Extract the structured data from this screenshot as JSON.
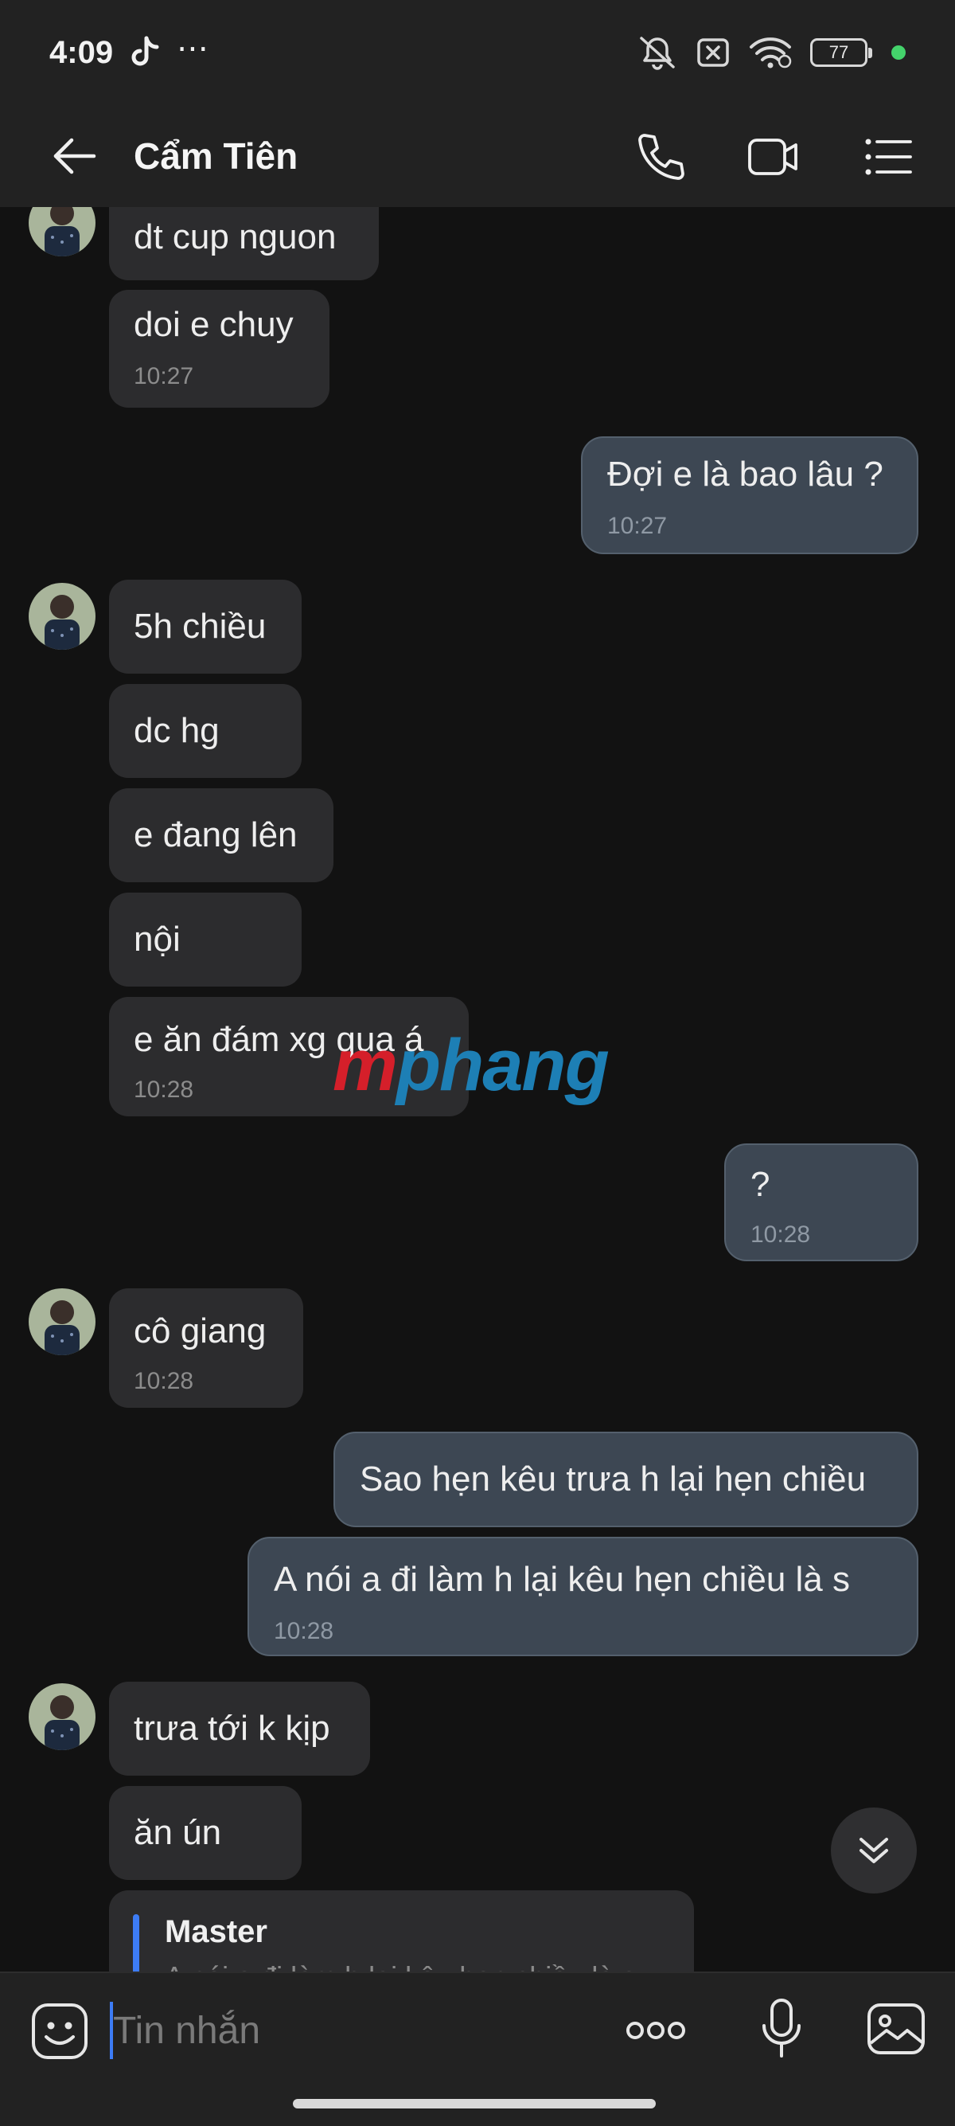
{
  "status_bar": {
    "time": "4:09",
    "more_glyph": "⋯",
    "battery_level": "77",
    "icons": [
      "tiktok-icon",
      "silent-icon",
      "sim-off-icon",
      "wifi-icon",
      "battery-icon",
      "green-dot"
    ]
  },
  "header": {
    "contact_name": "Cẩm Tiên",
    "actions": [
      "back-arrow-icon",
      "phone-call-icon",
      "video-call-icon",
      "menu-list-icon"
    ]
  },
  "messages": [
    {
      "sender": "contact",
      "text": "dt cup nguon",
      "time": ""
    },
    {
      "sender": "contact",
      "text": "doi e chuy",
      "time": "10:27"
    },
    {
      "sender": "me",
      "text": "Đợi e là bao lâu ?",
      "time": "10:27"
    },
    {
      "sender": "contact",
      "text": "5h chiều",
      "time": ""
    },
    {
      "sender": "contact",
      "text": "dc hg",
      "time": ""
    },
    {
      "sender": "contact",
      "text": "e đang lên",
      "time": ""
    },
    {
      "sender": "contact",
      "text": "nội",
      "time": ""
    },
    {
      "sender": "contact",
      "text": "e ăn đám xg qua á",
      "time": "10:28"
    },
    {
      "sender": "me",
      "text": "?",
      "time": "10:28"
    },
    {
      "sender": "contact",
      "text": "cô giang",
      "time": "10:28"
    },
    {
      "sender": "me",
      "text": "Sao hẹn kêu trưa h lại hẹn chiều",
      "time": ""
    },
    {
      "sender": "me",
      "text": "A nói a đi làm h lại kêu hẹn chiều là s",
      "time": "10:28"
    },
    {
      "sender": "contact",
      "text": "trưa tới k kịp",
      "time": ""
    },
    {
      "sender": "contact",
      "text": "ăn ún",
      "time": ""
    }
  ],
  "reply_preview": {
    "name": "Master",
    "quote": "A nói a đi làm h lại kêu hẹn chiều là s"
  },
  "watermark": {
    "part1": "m",
    "part2": "phang"
  },
  "input": {
    "placeholder": "Tin nhắn",
    "value": "",
    "icons": [
      "sticker-icon",
      "more-options-icon",
      "microphone-icon",
      "gallery-icon"
    ]
  },
  "colors": {
    "background": "#121212",
    "bar": "#222222",
    "received_bubble": "#2c2c2e",
    "sent_bubble": "#3d4753",
    "accent": "#3d7cf5"
  }
}
